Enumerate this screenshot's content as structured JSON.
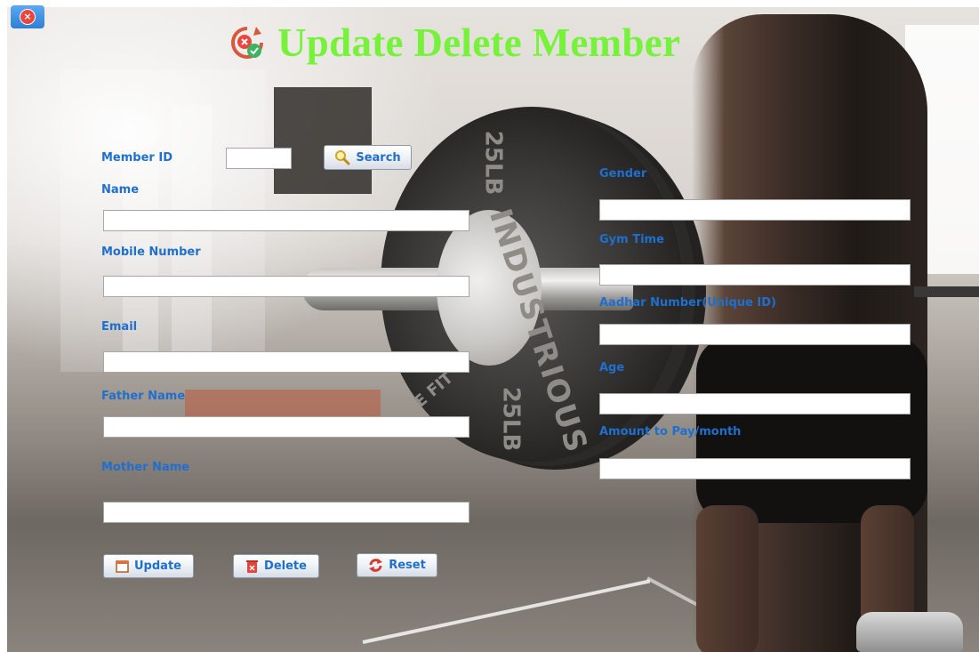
{
  "window": {
    "title": "Update Delete Member",
    "title_color": "#76F23A",
    "close_icon": "close-icon"
  },
  "form": {
    "label_color": "#1F6FCE",
    "member_id": {
      "label": "Member ID",
      "value": ""
    },
    "search_button": {
      "label": "Search",
      "icon": "search-icon"
    },
    "left_fields": [
      {
        "label": "Name",
        "value": ""
      },
      {
        "label": "Mobile Number",
        "value": ""
      },
      {
        "label": "Email",
        "value": ""
      },
      {
        "label": "Father Name",
        "value": ""
      },
      {
        "label": "Mother Name",
        "value": ""
      }
    ],
    "right_fields": [
      {
        "label": "Gender",
        "value": ""
      },
      {
        "label": "Gym Time",
        "value": ""
      },
      {
        "label": "Aadhar Number(Unique ID)",
        "value": ""
      },
      {
        "label": "Age",
        "value": ""
      },
      {
        "label": "Amount to Pay/month",
        "value": ""
      }
    ]
  },
  "actions": {
    "update": {
      "label": "Update",
      "icon": "calendar-icon"
    },
    "delete": {
      "label": "Delete",
      "icon": "trash-icon"
    },
    "reset": {
      "label": "Reset",
      "icon": "refresh-icon"
    }
  },
  "background": {
    "plate_text": [
      "25LB",
      "INDUSTRIOUS",
      "25LB",
      "E FIT"
    ]
  }
}
